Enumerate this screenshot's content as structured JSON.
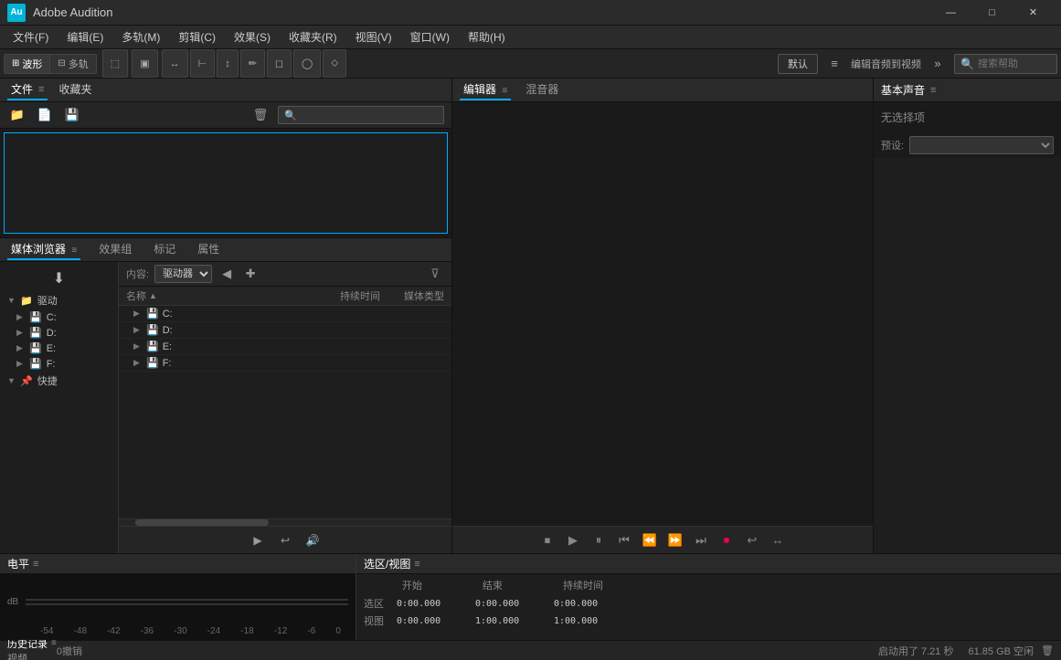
{
  "titleBar": {
    "appName": "Adobe Audition",
    "logoText": "Au",
    "minimizeLabel": "—",
    "maximizeLabel": "□",
    "closeLabel": "✕"
  },
  "menuBar": {
    "items": [
      {
        "label": "文件(F)"
      },
      {
        "label": "编辑(E)"
      },
      {
        "label": "多轨(M)"
      },
      {
        "label": "剪辑(C)"
      },
      {
        "label": "效果(S)"
      },
      {
        "label": "收藏夹(R)"
      },
      {
        "label": "视图(V)"
      },
      {
        "label": "窗口(W)"
      },
      {
        "label": "帮助(H)"
      }
    ]
  },
  "toolbar": {
    "waveformLabel": "波形",
    "multitrackLabel": "多轨",
    "defaultLabel": "默认",
    "editAudioToVideoLabel": "编辑音频到视频",
    "searchPlaceholder": "搜索帮助"
  },
  "filePanel": {
    "tabLabel": "文件",
    "collectionsLabel": "收藏夹"
  },
  "mediaBrowser": {
    "tabLabel": "媒体浏览器",
    "effectsLabel": "效果组",
    "markerLabel": "标记",
    "propertiesLabel": "属性",
    "contentLabel": "内容:",
    "driveLabel": "驱动器",
    "driveOption": "驱动器",
    "nameHeader": "名称",
    "durationHeader": "持续时间",
    "typeHeader": "媒体类型",
    "treeItems": [
      {
        "label": "驱动",
        "level": 0,
        "expanded": true,
        "isGroup": true
      },
      {
        "label": "C:",
        "level": 1,
        "isDrive": true
      },
      {
        "label": "D:",
        "level": 1,
        "isDrive": true
      },
      {
        "label": "E:",
        "level": 1,
        "isDrive": true
      },
      {
        "label": "F:",
        "level": 1,
        "isDrive": true
      },
      {
        "label": "快捷",
        "level": 0,
        "expanded": true,
        "isGroup": true
      }
    ],
    "tableRows": [
      {
        "name": "C:",
        "duration": "",
        "type": "",
        "isDrive": true
      },
      {
        "name": "D:",
        "duration": "",
        "type": "",
        "isDrive": true
      },
      {
        "name": "E:",
        "duration": "",
        "type": "",
        "isDrive": true
      },
      {
        "name": "F:",
        "duration": "",
        "type": "",
        "isDrive": true
      }
    ]
  },
  "editor": {
    "editorTabLabel": "编辑器",
    "mixerTabLabel": "混音器"
  },
  "basicSound": {
    "title": "基本声音",
    "noSelectionLabel": "无选择项",
    "presetLabel": "预设:"
  },
  "bottomHistory": {
    "historyLabel": "历史记录",
    "videoLabel": "视频",
    "undoText": "0撤销",
    "startupInfo": "启动用了 7.21 秒",
    "diskInfo": "61.85 GB 空闲"
  },
  "levelMeter": {
    "title": "电平"
  },
  "selectionView": {
    "title": "选区/视图",
    "startLabel": "开始",
    "endLabel": "结束",
    "durationLabel": "持续时间",
    "selectionLabel": "选区",
    "viewLabel": "视图",
    "selStart": "0:00.000",
    "selEnd": "0:00.000",
    "selDuration": "0:00.000",
    "viewStart": "0:00.000",
    "viewEnd": "1:00.000",
    "viewDuration": "1:00.000"
  },
  "dbScale": [
    "-54",
    "-48",
    "-42",
    "-36",
    "-30",
    "-24",
    "-18",
    "-12",
    "-6",
    "0"
  ]
}
